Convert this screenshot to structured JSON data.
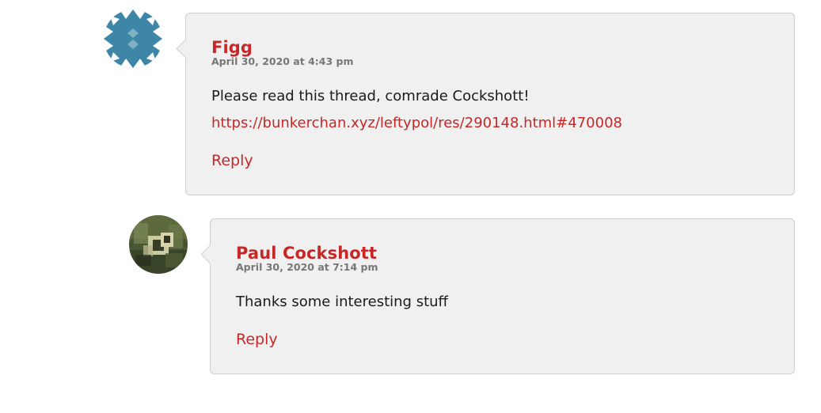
{
  "comments": [
    {
      "author": "Figg",
      "date": "April 30, 2020 at 4:43 pm",
      "text": "Please read this thread, comrade Cockshott!",
      "link": "https://bunkerchan.xyz/leftypol/res/290148.html#470008",
      "reply_label": "Reply",
      "avatar_icon": "identicon-avatar-icon"
    },
    {
      "author": "Paul Cockshott",
      "date": "April 30, 2020 at 7:14 pm",
      "text": "Thanks some interesting stuff",
      "reply_label": "Reply",
      "avatar_icon": "user-photo-avatar-icon"
    }
  ],
  "colors": {
    "accent": "#c62828",
    "bubble_bg": "#f0f0f0",
    "bubble_border": "#cfcfcf",
    "date_gray": "#777777",
    "identicon_blue": "#3d86a8"
  }
}
